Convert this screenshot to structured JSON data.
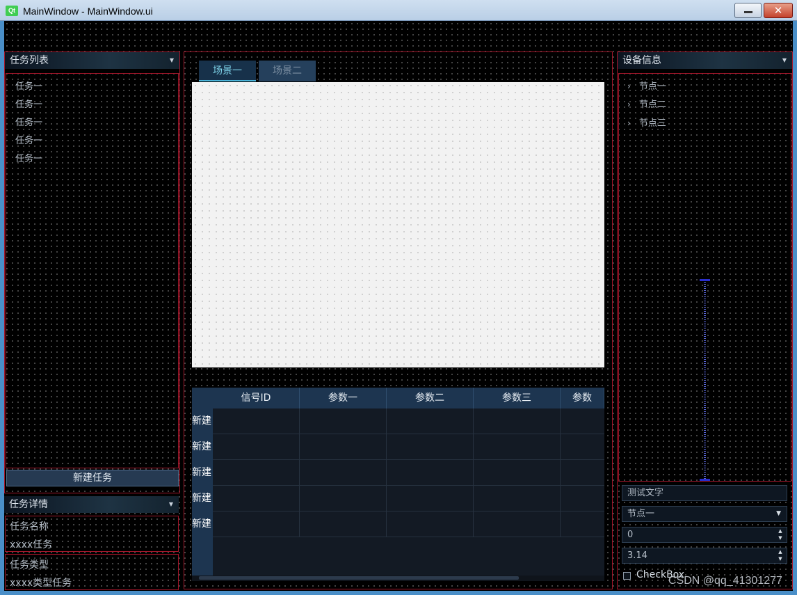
{
  "window": {
    "logo_text": "Qt",
    "title": "MainWindow - MainWindow.ui",
    "close_glyph": "✕"
  },
  "left_panel": {
    "task_list_title": "任务列表",
    "dropdown_glyph": "▼",
    "tasks": [
      "任务一",
      "任务一",
      "任务一",
      "任务一",
      "任务一"
    ],
    "new_task_button": "新建任务",
    "task_detail_title": "任务详情",
    "task_name_label": "任务名称",
    "task_name_value": "xxxx任务",
    "task_type_label": "任务类型",
    "task_type_value": "xxxx类型任务"
  },
  "center": {
    "tabs": [
      "场景一",
      "场景二"
    ],
    "active_tab": 0,
    "table": {
      "columns": [
        "信号ID",
        "参数一",
        "参数二",
        "参数三",
        "参数"
      ],
      "row_headers": [
        "新建",
        "新建",
        "新建",
        "新建",
        "新建"
      ]
    }
  },
  "right_panel": {
    "title": "设备信息",
    "dropdown_glyph": "▼",
    "tree_chevron": "›",
    "tree_nodes": [
      "节点一",
      "节点二",
      "节点三"
    ],
    "test_text": "测试文字",
    "combo_value": "节点一",
    "int_spin_value": "0",
    "double_spin_value": "3.14",
    "spin_up": "▲",
    "spin_down": "▼",
    "checkbox_label": "CheckBox"
  },
  "watermark": "CSDN @qq_41301277",
  "colors": {
    "border_red": "#a3162a",
    "header_blue": "#1d3550",
    "active_tab_text": "#7fd4ea"
  }
}
